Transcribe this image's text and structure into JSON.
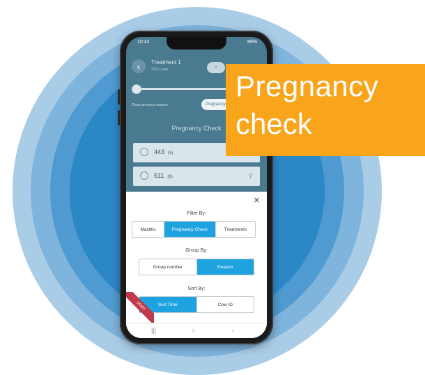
{
  "status_bar": {
    "time": "10:42",
    "battery": "89%"
  },
  "app_bar": {
    "title": "Treatment 1",
    "subtitle": "3115 Cows",
    "back_icon": "chevron-left-icon"
  },
  "previous_session": {
    "label": "Chain previous session",
    "chip": "Pregnancy Check"
  },
  "list": {
    "heading": "Pregnancy Check",
    "rows": [
      {
        "cow": "443",
        "count": "(5)"
      },
      {
        "cow": "511",
        "count": "(6)"
      }
    ]
  },
  "filter_sheet": {
    "close_icon": "close-icon",
    "filter_by": {
      "label": "Filter By:",
      "options": [
        "Mastitis",
        "Pregnancy Check",
        "Treatments"
      ],
      "selected": "Pregnancy Check"
    },
    "group_by": {
      "label": "Group By:",
      "options": [
        "Group number",
        "Reason"
      ],
      "selected": "Reason"
    },
    "sort_by": {
      "label": "Sort By:",
      "options": [
        "Sort Time",
        "Cow ID"
      ],
      "selected": "Sort Time"
    },
    "ribbon": "DEMO"
  },
  "callout": {
    "line1": "Pregnancy",
    "line2": "check"
  },
  "colors": {
    "accent_blue": "#1fa3e0",
    "callout_orange": "#f8a51b",
    "ring_blue": "#2c87c7"
  }
}
